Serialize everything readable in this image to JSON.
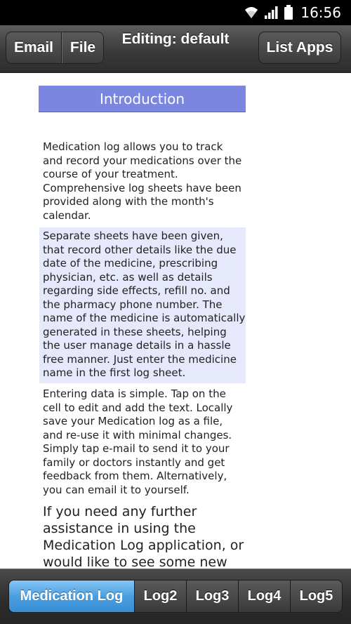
{
  "status_bar": {
    "time": "16:56",
    "icons": [
      "wifi-icon",
      "signal-icon",
      "battery-icon"
    ]
  },
  "top_bar": {
    "email_label": "Email",
    "file_label": "File",
    "title": "Editing: default",
    "list_apps_label": "List Apps"
  },
  "content": {
    "header": "Introduction",
    "paragraphs": [
      "Medication log allows you to track and record your medications over the course of your treatment. Comprehensive log sheets have been provided along with the month's calendar.",
      "Separate sheets have been given, that record other details like the due date of the medicine, prescribing physician, etc. as well as details regarding side effects, refill no. and the pharmacy phone number. The name of the medicine is automatically generated in these sheets, helping the user manage details in a hassle free manner. Just enter the medicine name in the first log sheet.",
      "Entering data is simple. Tap on the cell to edit and add the text. Locally save your Medication log as a file, and re-use it with minimal changes. Simply tap e-mail to send it to your family or doctors instantly and get feedback from them. Alternatively, you can email it to yourself.",
      "If you need any further assistance in using the Medication Log application, or would like to see some new features in the future versions"
    ]
  },
  "tabs": [
    {
      "label": "Medication Log",
      "active": true
    },
    {
      "label": "Log2",
      "active": false
    },
    {
      "label": "Log3",
      "active": false
    },
    {
      "label": "Log4",
      "active": false
    },
    {
      "label": "Log5",
      "active": false
    }
  ],
  "colors": {
    "header_bg": "#7b86e0",
    "highlight_bg": "#e6e8fb",
    "active_tab": "#4a9fe0",
    "bar_bg": "#3a3a3a"
  }
}
